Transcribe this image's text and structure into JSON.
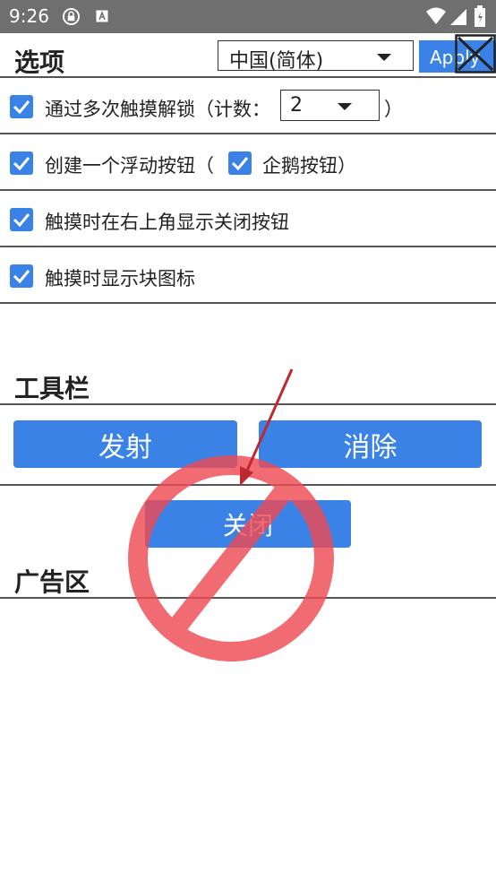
{
  "status_bar": {
    "time": "9:26",
    "icons": [
      "lock-icon",
      "a-icon",
      "wifi-icon",
      "signal-icon",
      "battery-icon"
    ]
  },
  "header": {
    "title": "选项",
    "language_select": {
      "value": "中国(简体)"
    },
    "apply_label": "Apply"
  },
  "options": [
    {
      "checked": true,
      "label": "通过多次触摸解锁（计数：",
      "count": "2",
      "suffix": "）"
    },
    {
      "checked": true,
      "label": "创建一个浮动按钮（",
      "sub_checked": true,
      "sub_label": "企鹅按钮）"
    },
    {
      "checked": true,
      "label": "触摸时在右上角显示关闭按钮"
    },
    {
      "checked": true,
      "label": "触摸时显示块图标"
    }
  ],
  "toolbar": {
    "title": "工具栏",
    "fire_label": "发射",
    "clear_label": "消除",
    "close_label": "关闭"
  },
  "ad_section": {
    "title": "广告区"
  },
  "colors": {
    "accent": "#3b82e6",
    "status_bar": "#6f6f6f",
    "prohibit_overlay": "#ee4b55",
    "arrow": "#c0282f"
  }
}
